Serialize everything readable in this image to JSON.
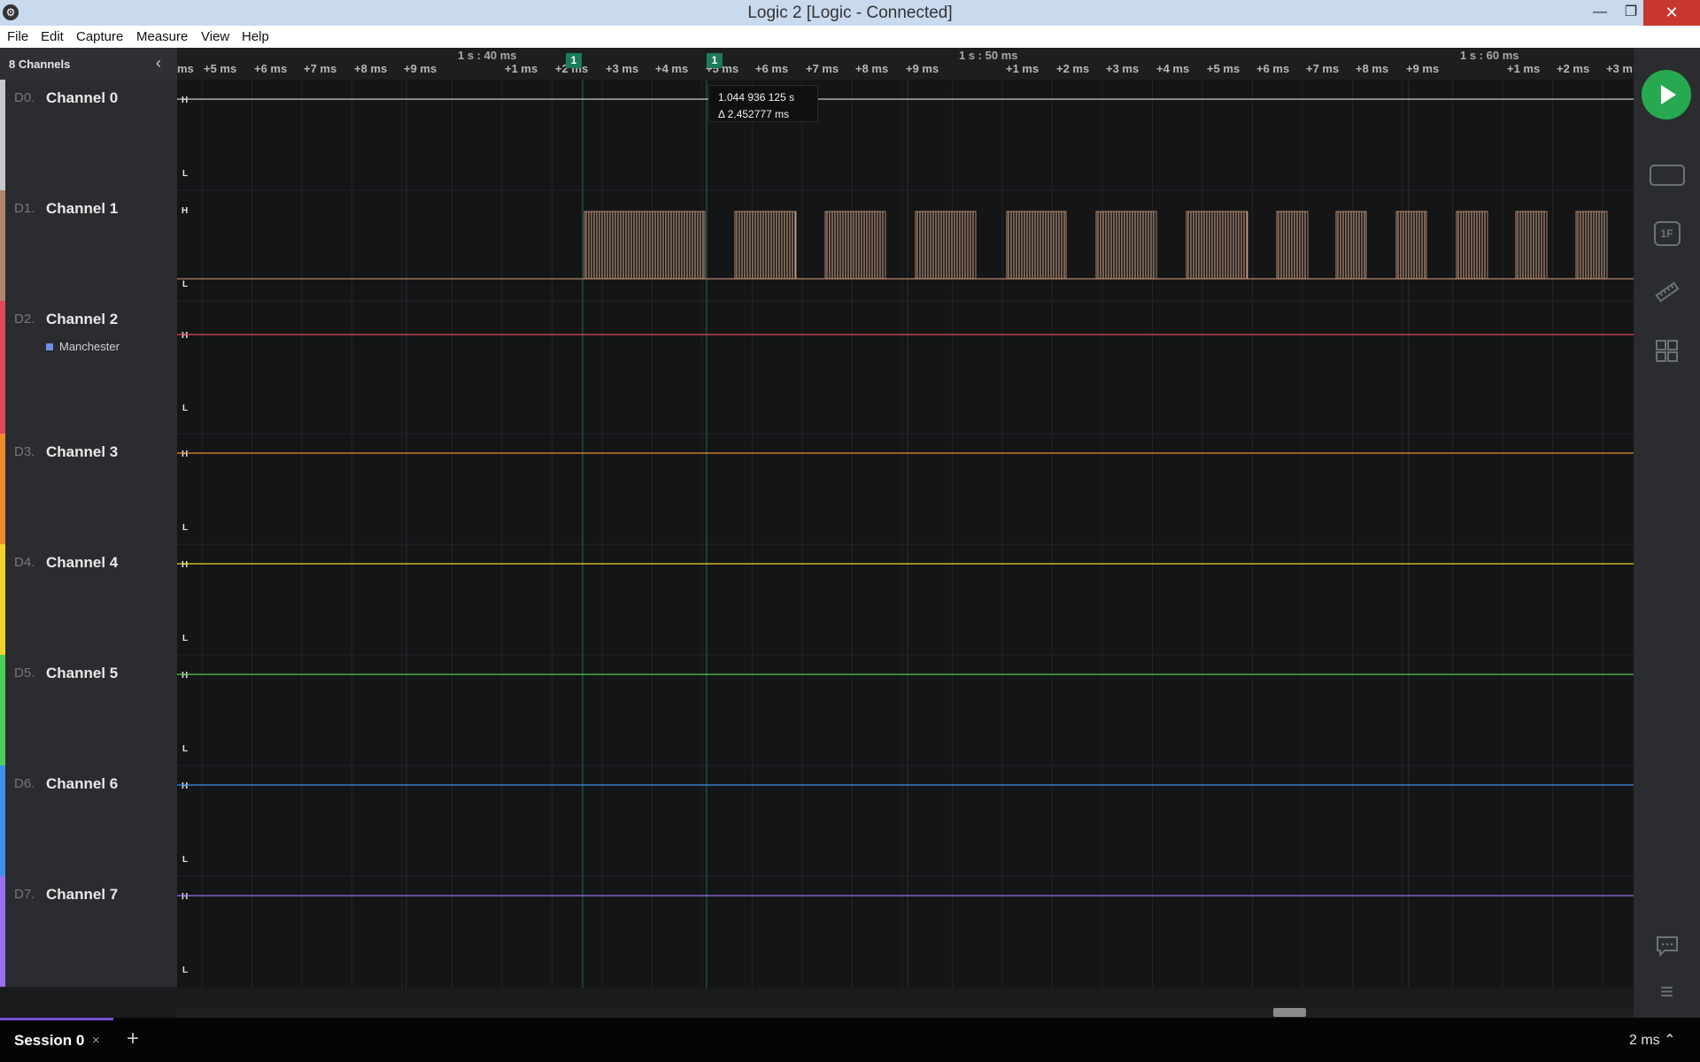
{
  "window": {
    "title": "Logic 2 [Logic - Connected]",
    "minimize": "—",
    "maximize": "❐",
    "close": "✕"
  },
  "menu": [
    "File",
    "Edit",
    "Capture",
    "Measure",
    "View",
    "Help"
  ],
  "channels_panel": {
    "count_label": "8 Channels",
    "collapse_icon": "‹"
  },
  "channels": [
    {
      "id": "D0.",
      "name": "Channel 0",
      "color": "#c9c9c9"
    },
    {
      "id": "D1.",
      "name": "Channel 1",
      "color": "#b5856a"
    },
    {
      "id": "D2.",
      "name": "Channel 2",
      "color": "#e0485a",
      "analyzer": "Manchester"
    },
    {
      "id": "D3.",
      "name": "Channel 3",
      "color": "#f08a2a"
    },
    {
      "id": "D4.",
      "name": "Channel 4",
      "color": "#f1d629"
    },
    {
      "id": "D5.",
      "name": "Channel 5",
      "color": "#4ccf5a"
    },
    {
      "id": "D6.",
      "name": "Channel 6",
      "color": "#3f8ef0"
    },
    {
      "id": "D7.",
      "name": "Channel 7",
      "color": "#9a6ff0"
    }
  ],
  "level_labels": {
    "high": "H",
    "low": "L"
  },
  "ruler": {
    "major": [
      "1 s : 40 ms",
      "1 s : 50 ms",
      "1 s : 60 ms"
    ],
    "ticks": [
      "ms",
      "+5 ms",
      "+6 ms",
      "+7 ms",
      "+8 ms",
      "+9 ms",
      "+1 ms",
      "+2 ms",
      "+3 ms",
      "+4 ms",
      "+5 ms",
      "+6 ms",
      "+7 ms",
      "+8 ms",
      "+9 ms",
      "+1 ms",
      "+2 ms",
      "+3 ms",
      "+4 ms",
      "+5 ms",
      "+6 ms",
      "+7 ms",
      "+8 ms",
      "+9 ms",
      "+1 ms",
      "+2 ms",
      "+3 m"
    ],
    "marker_labels": [
      "1",
      "1"
    ]
  },
  "measurement_tooltip": {
    "time": "1.044 936 125 s",
    "delta": "Δ 2.452777 ms"
  },
  "sessions": {
    "active": "Session 0",
    "close_icon": "×",
    "add_icon": "+"
  },
  "zoom": "2 ms ⌃",
  "colors": {
    "play": "#26a950",
    "marker": "#1b7a5c",
    "session_accent": "#7a4fd8"
  },
  "icons": {
    "play": "play-icon",
    "device": "device-icon",
    "analyzers": "analyzers-icon",
    "measurements": "ruler-icon",
    "extensions": "extensions-icon",
    "notes": "chat-icon",
    "menu": "hamburger-icon"
  },
  "toolbar_glyphs": {
    "analyzers": "1F",
    "measurements": "📏",
    "notes": "💬",
    "menu": "≡"
  }
}
